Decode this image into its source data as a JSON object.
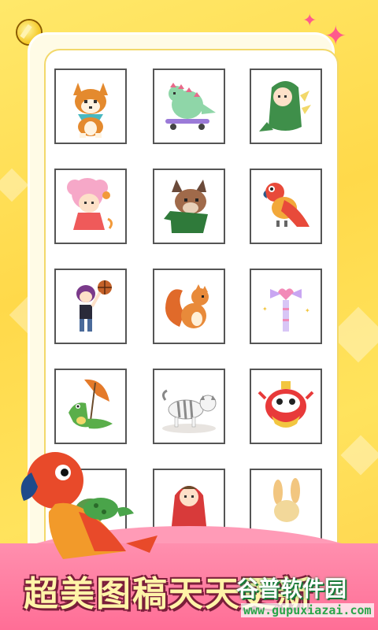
{
  "gallery": {
    "tiles": [
      {
        "icon": "shiba-dog-icon"
      },
      {
        "icon": "dinosaur-skateboard-icon"
      },
      {
        "icon": "dino-costume-kid-icon"
      },
      {
        "icon": "pink-hair-girl-icon"
      },
      {
        "icon": "bulldog-dino-costume-icon"
      },
      {
        "icon": "parrot-icon"
      },
      {
        "icon": "basketball-player-icon"
      },
      {
        "icon": "squirrel-icon"
      },
      {
        "icon": "magic-wand-icon"
      },
      {
        "icon": "crocodile-umbrella-icon"
      },
      {
        "icon": "cat-icon"
      },
      {
        "icon": "lion-dance-head-icon"
      },
      {
        "icon": "bird-icon"
      },
      {
        "icon": "red-hood-girl-icon"
      },
      {
        "icon": "bunny-icon"
      }
    ]
  },
  "banner": {
    "title": "超美图稿天天更新",
    "watermark": "谷普软件园",
    "watermark_url": "www.gupuxiazai.com"
  },
  "colors": {
    "background": "#ffe35d",
    "banner": "#ff6e96",
    "panel": "#ffffff"
  }
}
